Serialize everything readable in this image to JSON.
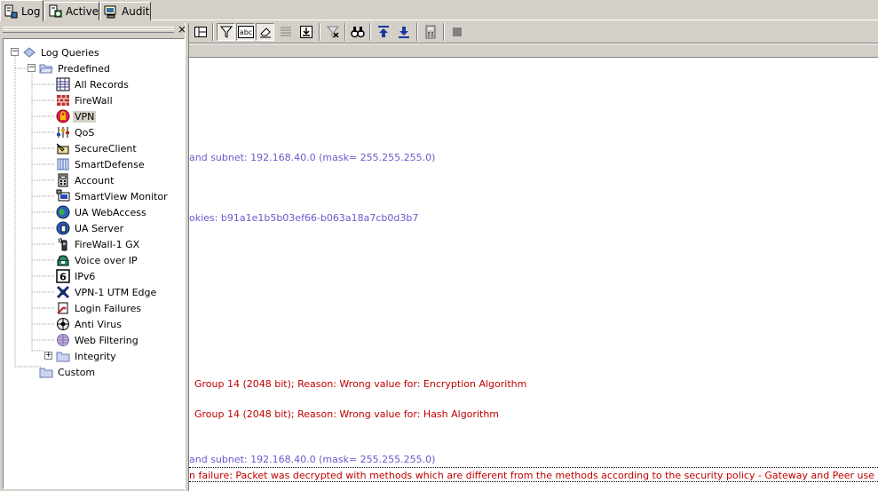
{
  "tabs": [
    {
      "label": "Log",
      "icon": "log-icon",
      "active": true
    },
    {
      "label": "Active",
      "icon": "active-icon",
      "active": false
    },
    {
      "label": "Audit",
      "icon": "audit-icon",
      "active": false
    }
  ],
  "left_pane": {
    "close_glyph": "×",
    "tree": {
      "root": {
        "label": "Log Queries",
        "icon": "log-queries-icon"
      },
      "predefined": {
        "label": "Predefined",
        "icon": "folder-open-icon"
      },
      "items": [
        {
          "label": "All Records",
          "icon": "all-records-icon"
        },
        {
          "label": "FireWall",
          "icon": "firewall-icon"
        },
        {
          "label": "VPN",
          "icon": "vpn-icon",
          "selected": true
        },
        {
          "label": "QoS",
          "icon": "qos-icon"
        },
        {
          "label": "SecureClient",
          "icon": "secureclient-icon"
        },
        {
          "label": "SmartDefense",
          "icon": "smartdefense-icon"
        },
        {
          "label": "Account",
          "icon": "account-icon"
        },
        {
          "label": "SmartView Monitor",
          "icon": "smartview-monitor-icon"
        },
        {
          "label": "UA WebAccess",
          "icon": "ua-webaccess-icon"
        },
        {
          "label": "UA Server",
          "icon": "ua-server-icon"
        },
        {
          "label": "FireWall-1 GX",
          "icon": "firewall-gx-icon"
        },
        {
          "label": "Voice over IP",
          "icon": "voip-icon"
        },
        {
          "label": "IPv6",
          "icon": "ipv6-icon"
        },
        {
          "label": "VPN-1 UTM Edge",
          "icon": "utm-edge-icon"
        },
        {
          "label": "Login Failures",
          "icon": "login-failures-icon"
        },
        {
          "label": "Anti Virus",
          "icon": "anti-virus-icon"
        },
        {
          "label": "Web Filtering",
          "icon": "web-filtering-icon"
        },
        {
          "label": "Integrity",
          "icon": "folder-icon"
        }
      ],
      "custom": {
        "label": "Custom",
        "icon": "folder-icon"
      }
    }
  },
  "toolbar": {
    "buttons": [
      "layout-icon",
      "filter-icon",
      "abc-icon",
      "eraser-icon",
      "rows-icon",
      "download-icon",
      "clear-filter-icon",
      "find-icon",
      "up-arrow-icon",
      "down-arrow-icon",
      "calculator-icon",
      "stop-icon"
    ]
  },
  "log_rows": [
    {
      "text": "and subnet: 192.168.40.0 (mask= 255.255.255.0)",
      "kind": "info"
    },
    {
      "text": "okies: b91a1e1b5b03ef66-b063a18a7cb0d3b7",
      "kind": "info"
    },
    {
      "text": "Group 14 (2048 bit); Reason: Wrong value for: Encryption Algorithm",
      "kind": "err"
    },
    {
      "text": "Group 14 (2048 bit); Reason: Wrong value for: Hash Algorithm",
      "kind": "err"
    },
    {
      "text": "and subnet: 192.168.40.0 (mask= 255.255.255.0)",
      "kind": "info"
    },
    {
      "text": "n failure: Packet was decrypted with methods which are different from the methods according to the security policy - Gateway and Peer use different DH groups.",
      "kind": "err"
    }
  ],
  "colors": {
    "info_text": "#6a5acd",
    "error_text": "#c00000",
    "chrome": "#d4d0c8"
  }
}
